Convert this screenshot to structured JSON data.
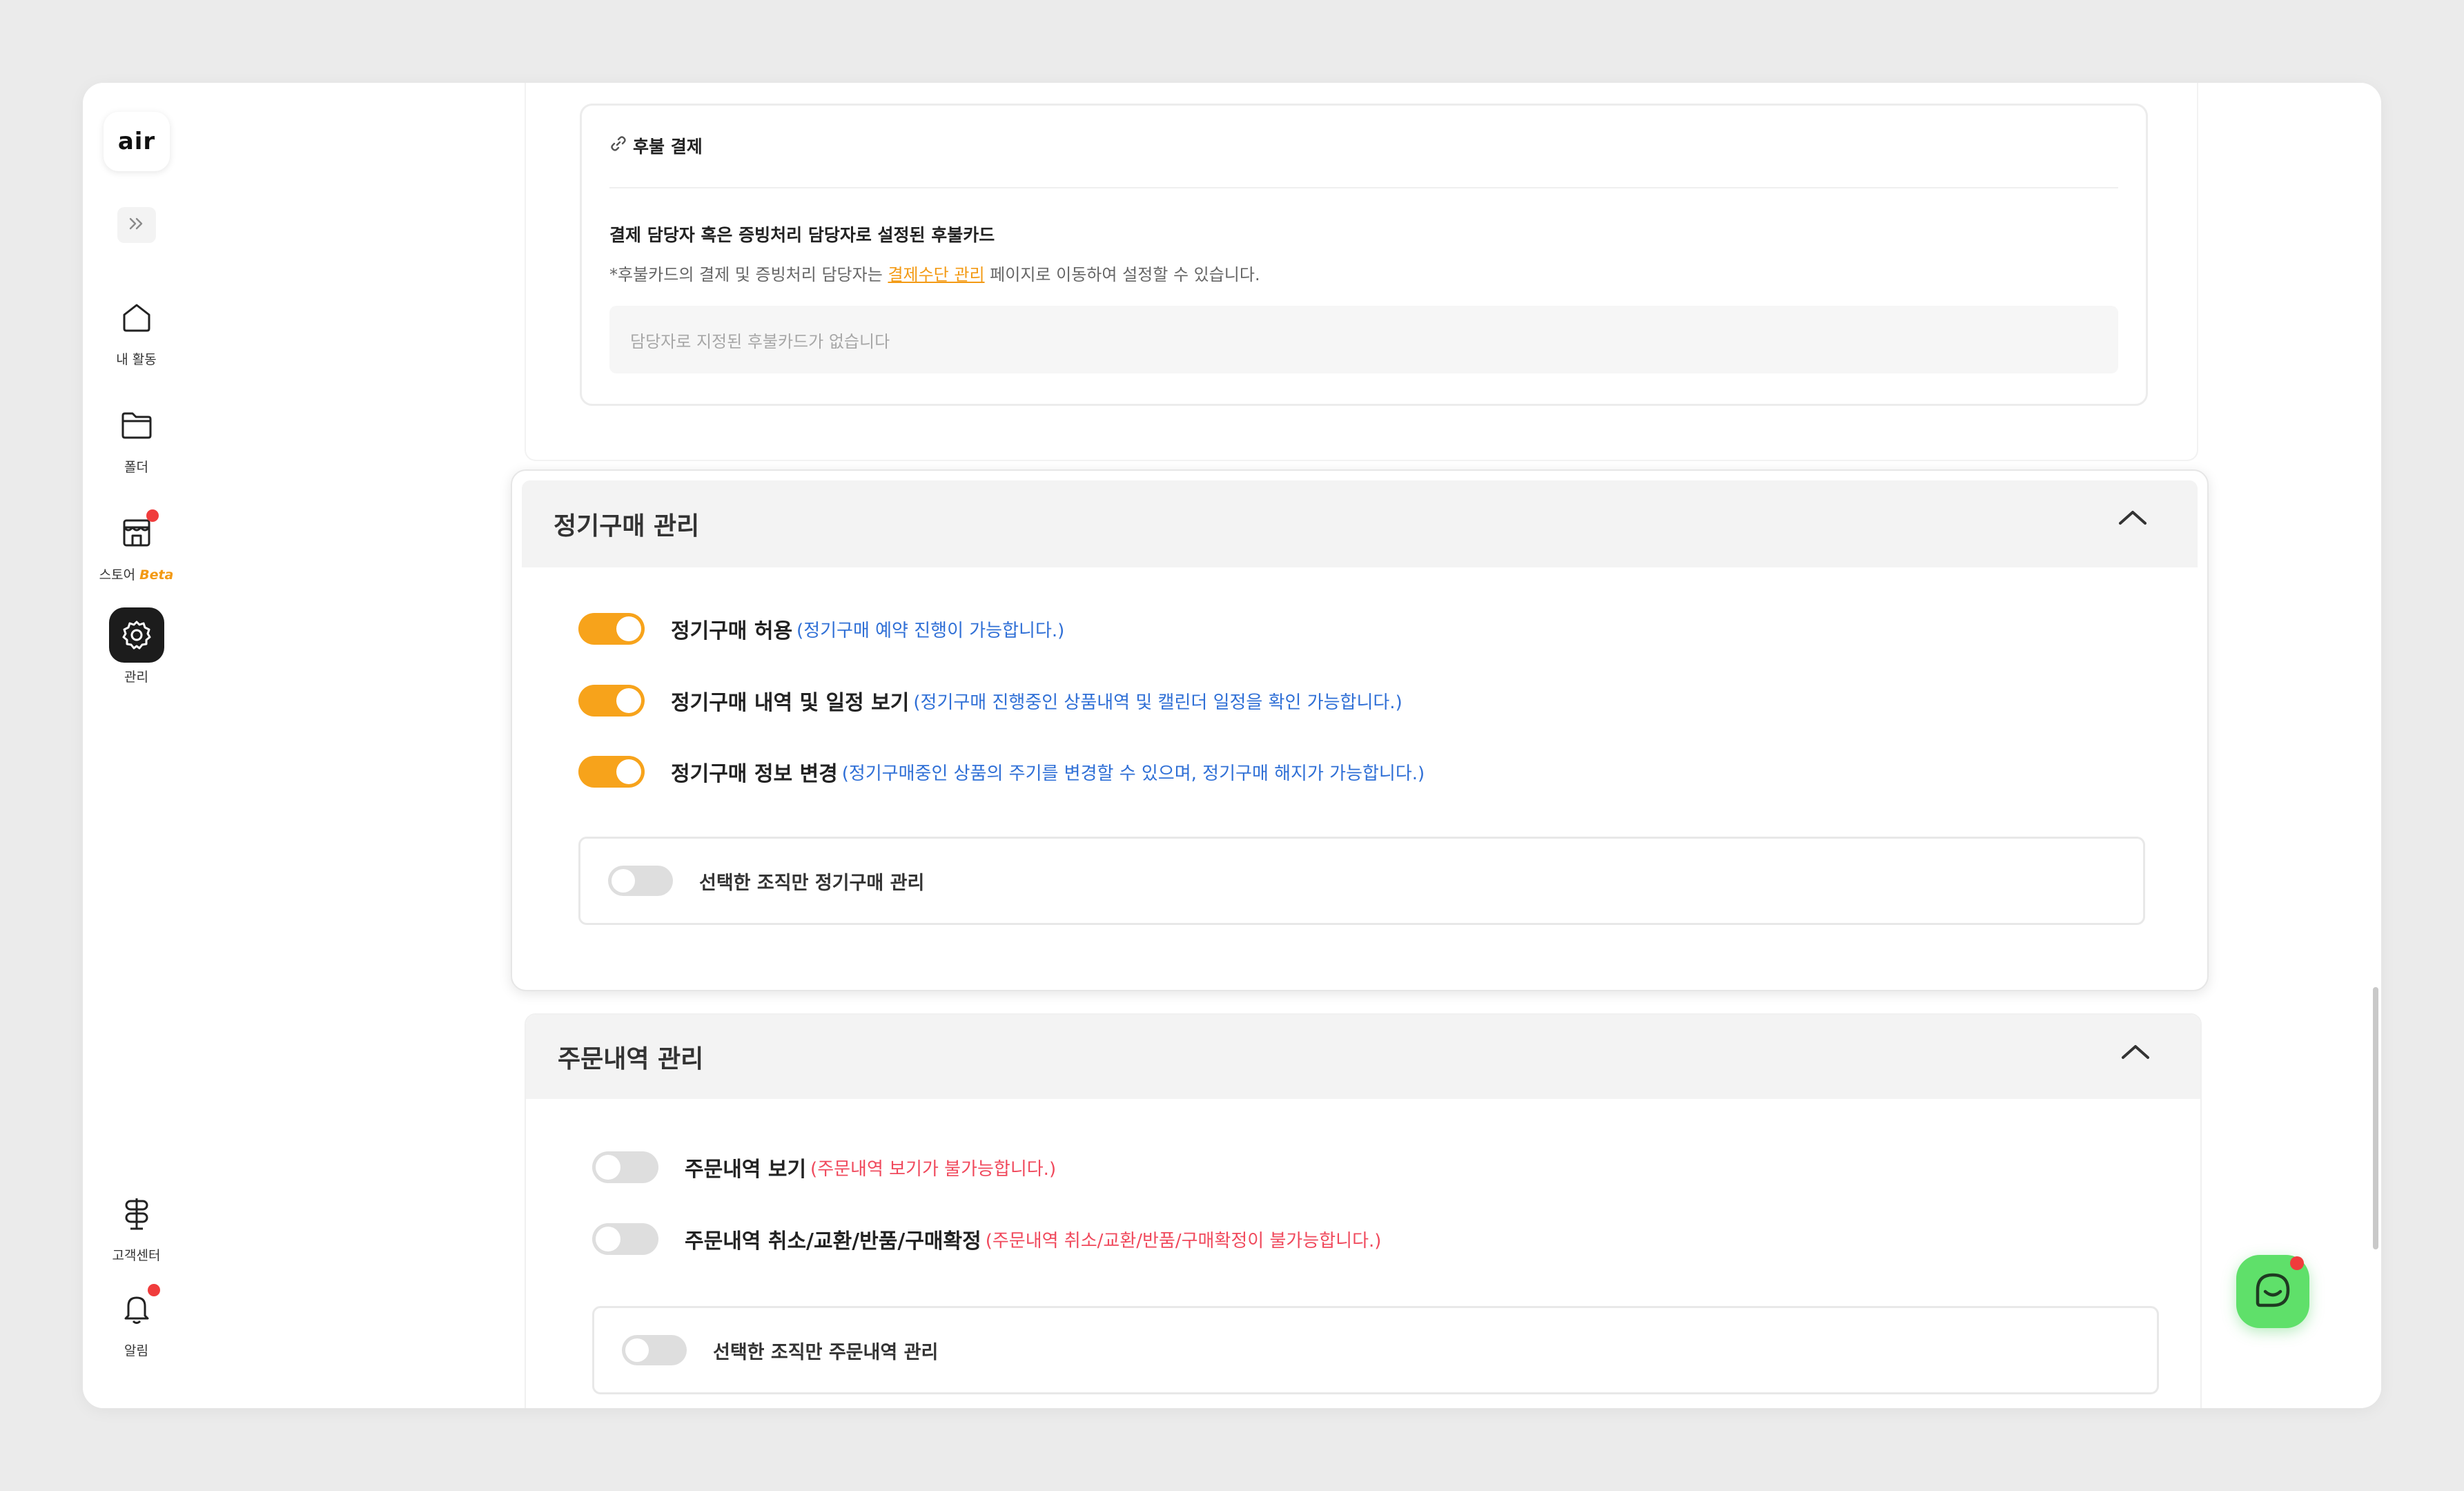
{
  "sidebar": {
    "logo": "air",
    "items": [
      {
        "label": "내 활동",
        "icon": "home-icon"
      },
      {
        "label": "폴더",
        "icon": "folder-icon"
      },
      {
        "label": "스토어",
        "badge": "Beta",
        "icon": "store-icon"
      },
      {
        "label": "관리",
        "icon": "gear-icon",
        "active": true
      },
      {
        "label": "고객센터",
        "icon": "signpost-icon"
      },
      {
        "label": "알림",
        "icon": "bell-icon"
      }
    ]
  },
  "deferred_payment": {
    "title": "후불 결제",
    "subtitle": "결제 담당자 혹은 증빙처리 담당자로 설정된 후불카드",
    "note_before": "*후불카드의 결제 및 증빙처리 담당자는 ",
    "note_link": "결제수단 관리",
    "note_after": " 페이지로 이동하여 설정할 수 있습니다.",
    "empty_text": "담당자로 지정된 후불카드가 없습니다"
  },
  "subscription": {
    "title": "정기구매 관리",
    "options": [
      {
        "label": "정기구매 허용",
        "desc": "(정기구매 예약 진행이 가능합니다.)",
        "enabled": true
      },
      {
        "label": "정기구매 내역 및 일정 보기",
        "desc": "(정기구매 진행중인 상품내역 및 캘린더 일정을 확인 가능합니다.)",
        "enabled": true
      },
      {
        "label": "정기구매 정보 변경",
        "desc": "(정기구매중인 상품의 주기를 변경할 수 있으며, 정기구매 해지가 가능합니다.)",
        "enabled": true
      }
    ],
    "selected_org_label": "선택한 조직만 정기구매 관리",
    "selected_org_enabled": false
  },
  "orders": {
    "title": "주문내역 관리",
    "options": [
      {
        "label": "주문내역 보기",
        "desc": "(주문내역 보기가 불가능합니다.)",
        "enabled": false
      },
      {
        "label": "주문내역 취소/교환/반품/구매확정",
        "desc": "(주문내역 취소/교환/반품/구매확정이 불가능합니다.)",
        "enabled": false
      }
    ],
    "selected_org_label": "선택한 조직만 주문내역 관리",
    "selected_org_enabled": false
  },
  "colors": {
    "accent": "#f7a31b",
    "desc_on": "#2f6fd6",
    "desc_off": "#f0495c",
    "chat": "#5fe06a",
    "notification": "#f03c3c"
  }
}
